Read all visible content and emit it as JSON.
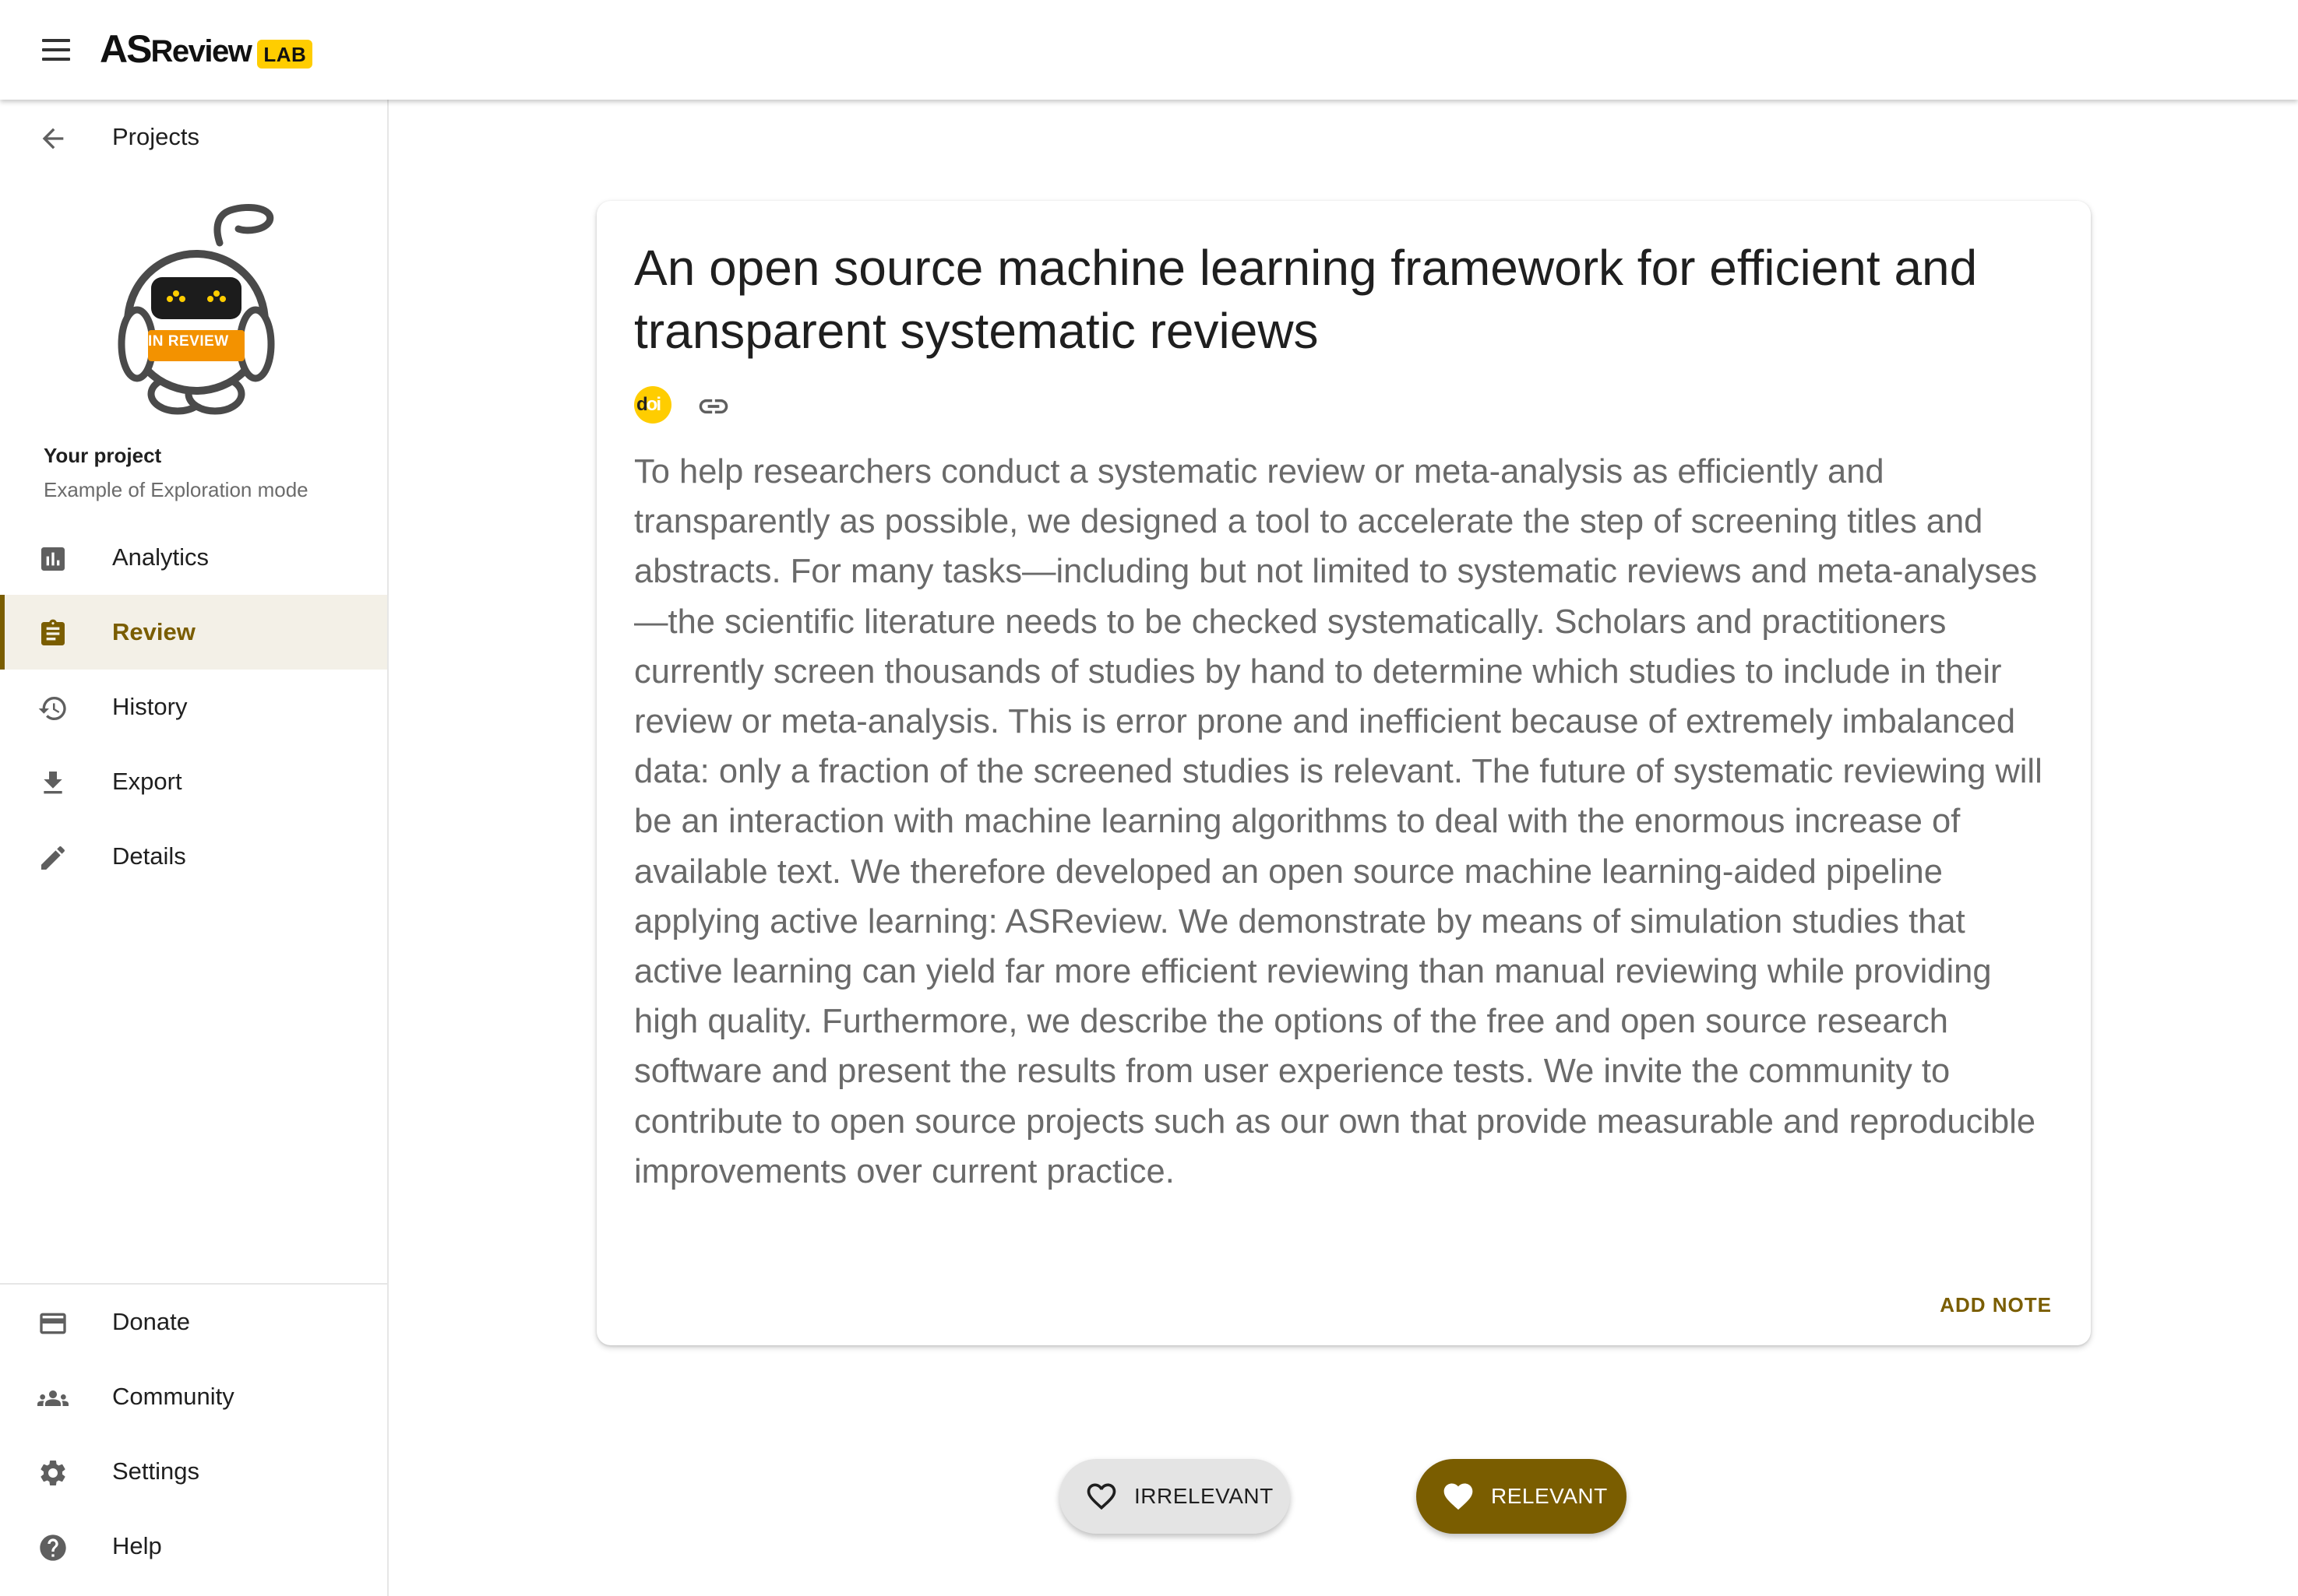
{
  "app": {
    "logo_main": "AS",
    "logo_review": "Review",
    "logo_badge": "LAB"
  },
  "sidebar": {
    "back_label": "Projects",
    "robot_badge": "IN REVIEW",
    "project_heading": "Your project",
    "project_name": "Example of Exploration mode",
    "nav": [
      {
        "label": "Analytics",
        "icon": "analytics-icon"
      },
      {
        "label": "Review",
        "icon": "clipboard-icon",
        "active": true
      },
      {
        "label": "History",
        "icon": "history-icon"
      },
      {
        "label": "Export",
        "icon": "download-icon"
      },
      {
        "label": "Details",
        "icon": "pencil-icon"
      }
    ],
    "footer": [
      {
        "label": "Donate",
        "icon": "credit-card-icon"
      },
      {
        "label": "Community",
        "icon": "people-icon"
      },
      {
        "label": "Settings",
        "icon": "gear-icon"
      },
      {
        "label": "Help",
        "icon": "help-icon"
      }
    ]
  },
  "record": {
    "title": "An open source machine learning framework for efficient and transparent systematic reviews",
    "doi_icon_text": "doi",
    "abstract": "To help researchers conduct a systematic review or meta-analysis as efficiently and transparently as possible, we designed a tool to accelerate the step of screening titles and abstracts. For many tasks—including but not limited to systematic reviews and meta-analyses—the scientific literature needs to be checked systematically. Scholars and practitioners currently screen thousands of studies by hand to determine which studies to include in their review or meta-analysis. This is error prone and inefficient because of extremely imbalanced data: only a fraction of the screened studies is relevant. The future of systematic reviewing will be an interaction with machine learning algorithms to deal with the enormous increase of available text. We therefore developed an open source machine learning-aided pipeline applying active learning: ASReview. We demonstrate by means of simulation studies that active learning can yield far more efficient reviewing than manual reviewing while providing high quality. Furthermore, we describe the options of the free and open source research software and present the results from user experience tests. We invite the community to contribute to open source projects such as our own that provide measurable and reproducible improvements over current practice.",
    "add_note_label": "ADD NOTE"
  },
  "decision": {
    "irrelevant_label": "IRRELEVANT",
    "relevant_label": "RELEVANT"
  },
  "colors": {
    "accent": "#7a5d00",
    "brand_yellow": "#FFCD00",
    "active_bg": "#f3f0e7"
  }
}
